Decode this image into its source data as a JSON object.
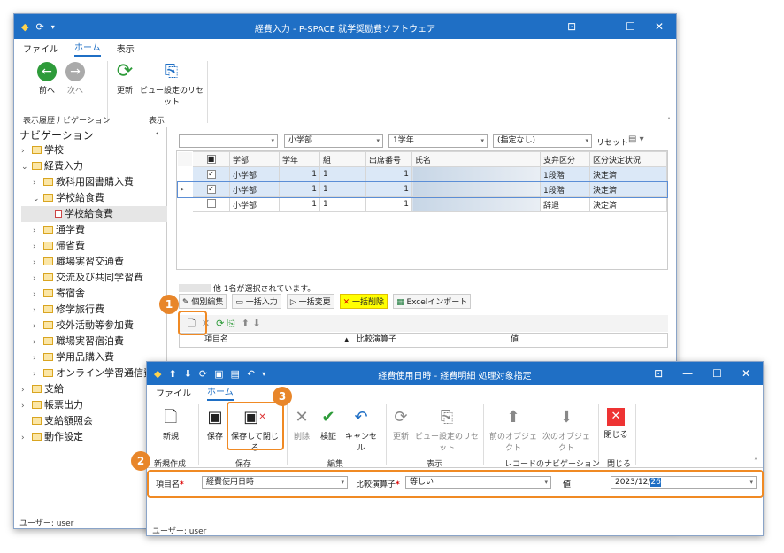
{
  "main": {
    "title": "経費入力 - P-SPACE 就学奨励費ソフトウェア",
    "menu": [
      "ファイル",
      "ホーム",
      "表示"
    ],
    "ribbon": {
      "back": "前へ",
      "forward": "次へ",
      "refresh": "更新",
      "view_reset": "ビュー設定のリセット",
      "group_history": "表示履歴ナビゲーション",
      "group_view": "表示"
    },
    "nav_title": "ナビゲーション",
    "nav_items": [
      {
        "label": "学校",
        "lvl": 0,
        "exp": ">"
      },
      {
        "label": "経費入力",
        "lvl": 0,
        "exp": "v"
      },
      {
        "label": "教科用図書購入費",
        "lvl": 1,
        "exp": ">"
      },
      {
        "label": "学校給食費",
        "lvl": 1,
        "exp": "v"
      },
      {
        "label": "学校給食費",
        "lvl": 2,
        "exp": "",
        "sel": true
      },
      {
        "label": "通学費",
        "lvl": 1,
        "exp": ">"
      },
      {
        "label": "帰省費",
        "lvl": 1,
        "exp": ">"
      },
      {
        "label": "職場実習交通費",
        "lvl": 1,
        "exp": ">"
      },
      {
        "label": "交流及び共同学習費",
        "lvl": 1,
        "exp": ">"
      },
      {
        "label": "寄宿舎",
        "lvl": 1,
        "exp": ">"
      },
      {
        "label": "修学旅行費",
        "lvl": 1,
        "exp": ">"
      },
      {
        "label": "校外活動等参加費",
        "lvl": 1,
        "exp": ">"
      },
      {
        "label": "職場実習宿泊費",
        "lvl": 1,
        "exp": ">"
      },
      {
        "label": "学用品購入費",
        "lvl": 1,
        "exp": ">"
      },
      {
        "label": "オンライン学習通信費",
        "lvl": 1,
        "exp": ">"
      },
      {
        "label": "支給",
        "lvl": 0,
        "exp": ">"
      },
      {
        "label": "帳票出力",
        "lvl": 0,
        "exp": ">"
      },
      {
        "label": "支給額照会",
        "lvl": 0,
        "exp": ""
      },
      {
        "label": "動作設定",
        "lvl": 0,
        "exp": ">"
      }
    ],
    "filters": {
      "dept": "小学部",
      "grade": "1学年",
      "other": "(指定なし)",
      "reset": "リセット"
    },
    "columns": [
      "学部",
      "学年",
      "組",
      "出席番号",
      "氏名",
      "支弁区分",
      "区分決定状況"
    ],
    "rows": [
      [
        "小学部",
        "1",
        "1",
        "1",
        "",
        "1段階",
        "決定済"
      ],
      [
        "小学部",
        "1",
        "1",
        "1",
        "",
        "1段階",
        "決定済"
      ],
      [
        "小学部",
        "1",
        "1",
        "1",
        "",
        "辞退",
        "決定済"
      ]
    ],
    "selection_text": "他 1名が選択されています。",
    "tabs": [
      "個別編集",
      "一括入力",
      "一括変更",
      "一括削除",
      "Excelインポート"
    ],
    "sub_columns": [
      "項目名",
      "比較演算子",
      "値"
    ],
    "status": "ユーザー: user"
  },
  "dialog": {
    "title": "経費使用日時 - 経費明細 処理対象指定",
    "menu": [
      "ファイル",
      "ホーム"
    ],
    "buttons": [
      "新規",
      "保存",
      "保存して閉じる",
      "削除",
      "検証",
      "キャンセル",
      "更新",
      "ビュー設定のリセット",
      "前のオブジェクト",
      "次のオブジェクト",
      "閉じる"
    ],
    "groups": [
      "新規作成",
      "保存",
      "編集",
      "表示",
      "レコードのナビゲーション",
      "閉じる"
    ],
    "field_label": "項目名",
    "field_value": "経費使用日時",
    "op_label": "比較演算子",
    "op_value": "等しい",
    "val_label": "値",
    "val_date": "2023/12/",
    "val_day": "26",
    "status": "ユーザー: user"
  },
  "badges": [
    "1",
    "2",
    "3"
  ],
  "accent": "#1f6fc5",
  "highlight": "#f08a24"
}
